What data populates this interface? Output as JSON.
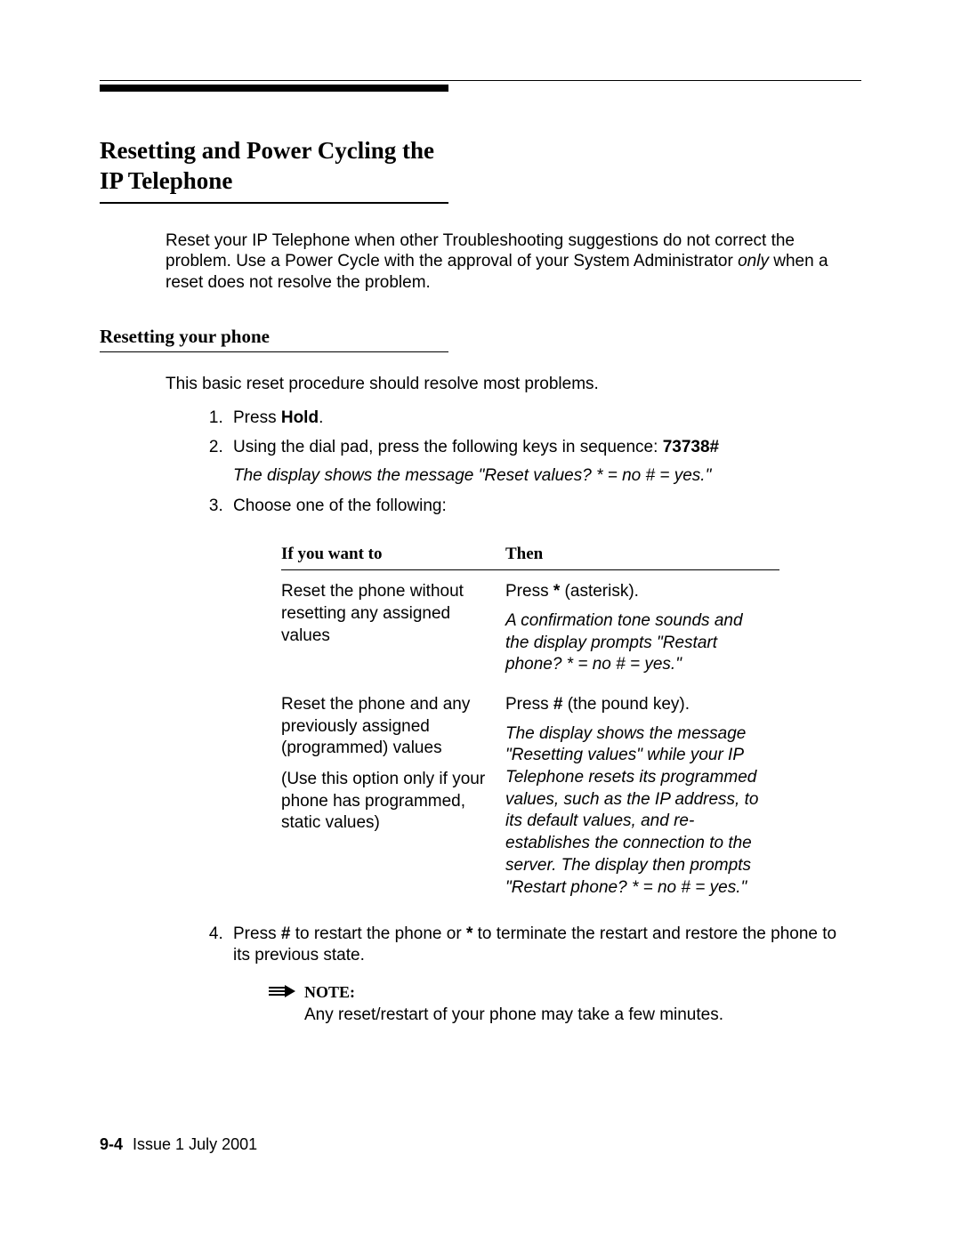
{
  "title": "Resetting and Power Cycling the IP Telephone",
  "intro": {
    "p1a": "Reset your IP Telephone when other Troubleshooting suggestions do not correct the problem. Use a Power Cycle with the approval of your System Administrator ",
    "p1b_italic": "only",
    "p1c": " when a reset does not resolve the problem."
  },
  "section": {
    "heading": "Resetting your phone",
    "lead": "This basic reset procedure should resolve most problems."
  },
  "steps": {
    "s1a": "Press ",
    "s1b_bold": "Hold",
    "s1c": ".",
    "s2a": "Using the dial pad, press the following keys in sequence: ",
    "s2b_bold": "73738#",
    "s2_sub_italic": "The display shows the message \"Reset values? * = no # = yes.\"",
    "s3": "Choose one of the following:",
    "s4a": "Press ",
    "s4b_bold": "#",
    "s4c": " to restart the phone or ",
    "s4d_bold": "*",
    "s4e": " to terminate the restart and restore the phone to its previous state."
  },
  "table": {
    "h1": "If you want to",
    "h2": "Then",
    "r1c1": "Reset the phone without resetting any assigned values",
    "r1c2a": "Press ",
    "r1c2a_bold": "*",
    "r1c2a_tail": " (asterisk).",
    "r1c2b_italic": "A confirmation tone sounds and the display prompts \"Restart phone? * = no # = yes.\"",
    "r2c1a": "Reset the phone and any previously assigned (programmed) values",
    "r2c1b": "(Use this option only if your phone has programmed, static values)",
    "r2c2a": "Press ",
    "r2c2a_bold": "#",
    "r2c2a_tail": " (the pound key).",
    "r2c2b_italic": "The display shows the message \"Resetting values\" while your IP Telephone resets its programmed values, such as the IP address, to its default values, and re-establishes the connection to the server. The display then prompts \"Restart phone? * = no # = yes.\""
  },
  "note": {
    "label": "NOTE:",
    "text": "Any reset/restart of your phone may take a few minutes."
  },
  "footer": {
    "page": "9-4",
    "issue": "Issue  1   July 2001"
  }
}
